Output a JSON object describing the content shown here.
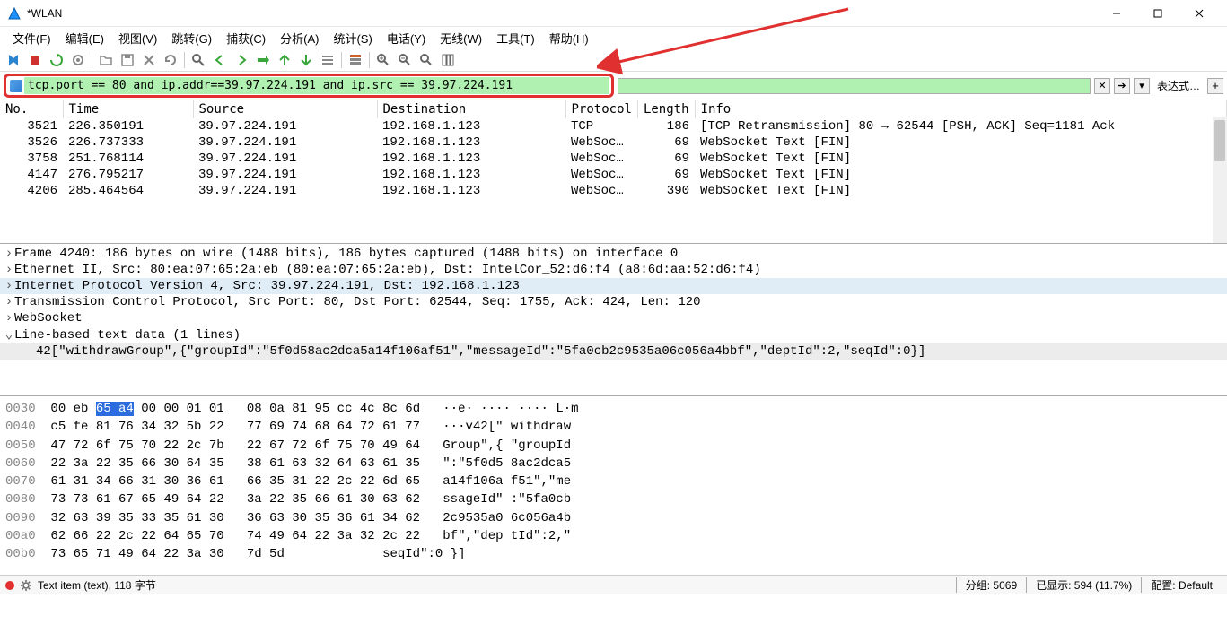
{
  "title": "*WLAN",
  "menus": {
    "file": "文件(F)",
    "edit": "编辑(E)",
    "view": "视图(V)",
    "go": "跳转(G)",
    "capture": "捕获(C)",
    "analyze": "分析(A)",
    "stats": "统计(S)",
    "tele": "电话(Y)",
    "wireless": "无线(W)",
    "tools": "工具(T)",
    "help": "帮助(H)"
  },
  "filter": {
    "value": "tcp.port == 80 and ip.addr==39.97.224.191 and ip.src == 39.97.224.191",
    "expression_label": "表达式…"
  },
  "columns": {
    "no": "No.",
    "time": "Time",
    "source": "Source",
    "dest": "Destination",
    "proto": "Protocol",
    "len": "Length",
    "info": "Info"
  },
  "packets": [
    {
      "no": "3521",
      "time": "226.350191",
      "src": "39.97.224.191",
      "dst": "192.168.1.123",
      "proto": "TCP",
      "len": "186",
      "info": "[TCP Retransmission] 80 → 62544 [PSH, ACK] Seq=1181 Ack"
    },
    {
      "no": "3526",
      "time": "226.737333",
      "src": "39.97.224.191",
      "dst": "192.168.1.123",
      "proto": "WebSoc…",
      "len": "69",
      "info": "WebSocket Text [FIN]"
    },
    {
      "no": "3758",
      "time": "251.768114",
      "src": "39.97.224.191",
      "dst": "192.168.1.123",
      "proto": "WebSoc…",
      "len": "69",
      "info": "WebSocket Text [FIN]"
    },
    {
      "no": "4147",
      "time": "276.795217",
      "src": "39.97.224.191",
      "dst": "192.168.1.123",
      "proto": "WebSoc…",
      "len": "69",
      "info": "WebSocket Text [FIN]"
    },
    {
      "no": "4206",
      "time": "285.464564",
      "src": "39.97.224.191",
      "dst": "192.168.1.123",
      "proto": "WebSoc…",
      "len": "390",
      "info": "WebSocket Text [FIN]"
    }
  ],
  "details": {
    "frame": "Frame 4240: 186 bytes on wire (1488 bits), 186 bytes captured (1488 bits) on interface 0",
    "eth": "Ethernet II, Src: 80:ea:07:65:2a:eb (80:ea:07:65:2a:eb), Dst: IntelCor_52:d6:f4 (a8:6d:aa:52:d6:f4)",
    "ip": "Internet Protocol Version 4, Src: 39.97.224.191, Dst: 192.168.1.123",
    "tcp": "Transmission Control Protocol, Src Port: 80, Dst Port: 62544, Seq: 1755, Ack: 424, Len: 120",
    "ws": "WebSocket",
    "lbtext": "Line-based text data (1 lines)",
    "payload": "42[\"withdrawGroup\",{\"groupId\":\"5f0d58ac2dca5a14f106af51\",\"messageId\":\"5fa0cb2c9535a06c056a4bbf\",\"deptId\":2,\"seqId\":0}]"
  },
  "hex": [
    {
      "off": "0030",
      "h1": "00 eb ",
      "hsel": "65 a4",
      "h2": " 00 00 01 01   08 0a 81 95 cc 4c 8c 6d",
      "asc": "   ··e· ···· ···· L·m"
    },
    {
      "off": "0040",
      "h1": "c5 fe 81 76 34 32 5b 22   77 69 74 68 64 72 61 77",
      "hsel": "",
      "h2": "",
      "asc": "   ···v42[\" withdraw"
    },
    {
      "off": "0050",
      "h1": "47 72 6f 75 70 22 2c 7b   22 67 72 6f 75 70 49 64",
      "hsel": "",
      "h2": "",
      "asc": "   Group\",{ \"groupId"
    },
    {
      "off": "0060",
      "h1": "22 3a 22 35 66 30 64 35   38 61 63 32 64 63 61 35",
      "hsel": "",
      "h2": "",
      "asc": "   \":\"5f0d5 8ac2dca5"
    },
    {
      "off": "0070",
      "h1": "61 31 34 66 31 30 36 61   66 35 31 22 2c 22 6d 65",
      "hsel": "",
      "h2": "",
      "asc": "   a14f106a f51\",\"me"
    },
    {
      "off": "0080",
      "h1": "73 73 61 67 65 49 64 22   3a 22 35 66 61 30 63 62",
      "hsel": "",
      "h2": "",
      "asc": "   ssageId\" :\"5fa0cb"
    },
    {
      "off": "0090",
      "h1": "32 63 39 35 33 35 61 30   36 63 30 35 36 61 34 62",
      "hsel": "",
      "h2": "",
      "asc": "   2c9535a0 6c056a4b"
    },
    {
      "off": "00a0",
      "h1": "62 66 22 2c 22 64 65 70   74 49 64 22 3a 32 2c 22",
      "hsel": "",
      "h2": "",
      "asc": "   bf\",\"dep tId\":2,\""
    },
    {
      "off": "00b0",
      "h1": "73 65 71 49 64 22 3a 30   7d 5d",
      "hsel": "",
      "h2": "",
      "asc": "             seqId\":0 }]"
    }
  ],
  "status": {
    "left": "Text item (text), 118 字节",
    "packets": "分组: 5069",
    "displayed": "已显示: 594 (11.7%)",
    "profile": "配置: Default"
  }
}
